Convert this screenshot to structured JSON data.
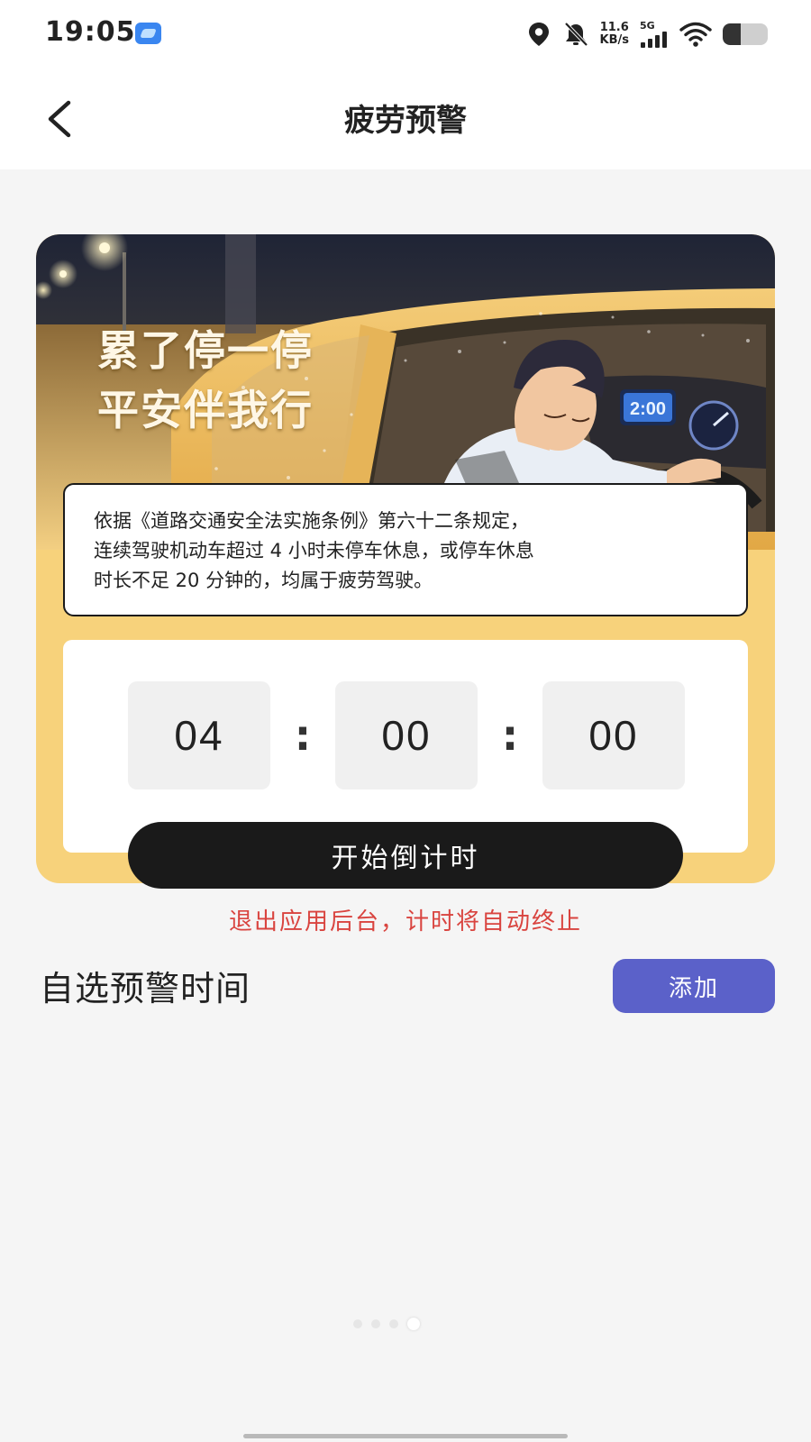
{
  "status_bar": {
    "time": "19:05",
    "net_speed_value": "11.6",
    "net_speed_unit": "KB/s",
    "signal_label": "5G",
    "battery_level": 0.4,
    "icons": [
      "app-badge-icon",
      "location-icon",
      "bell-muted-icon",
      "signal-icon",
      "wifi-icon",
      "battery-icon"
    ]
  },
  "header": {
    "title": "疲劳预警",
    "back_icon": "chevron-left-icon"
  },
  "hero": {
    "slogan_line1": "累了停一停",
    "slogan_line2": "平安伴我行",
    "dashboard_clock": "2:00"
  },
  "law_notice": {
    "line1": "依据《道路交通安全法实施条例》第六十二条规定，",
    "line2": "连续驾驶机动车超过 4 小时未停车休息，或停车休息",
    "line3": "时长不足 20 分钟的，均属于疲劳驾驶。"
  },
  "timer": {
    "hours": "04",
    "minutes": "00",
    "seconds": "00",
    "separator": ":"
  },
  "start_button_label": "开始倒计时",
  "warning_text": "退出应用后台，计时将自动终止",
  "custom_section": {
    "title": "自选预警时间",
    "add_button_label": "添加"
  },
  "pager": {
    "count": 4,
    "active_index": 3
  },
  "colors": {
    "card_bg": "#f7d27b",
    "start_button": "#1a1a1a",
    "warning": "#d9443f",
    "add_button": "#5b61c9",
    "page_bg": "#f5f5f5"
  }
}
